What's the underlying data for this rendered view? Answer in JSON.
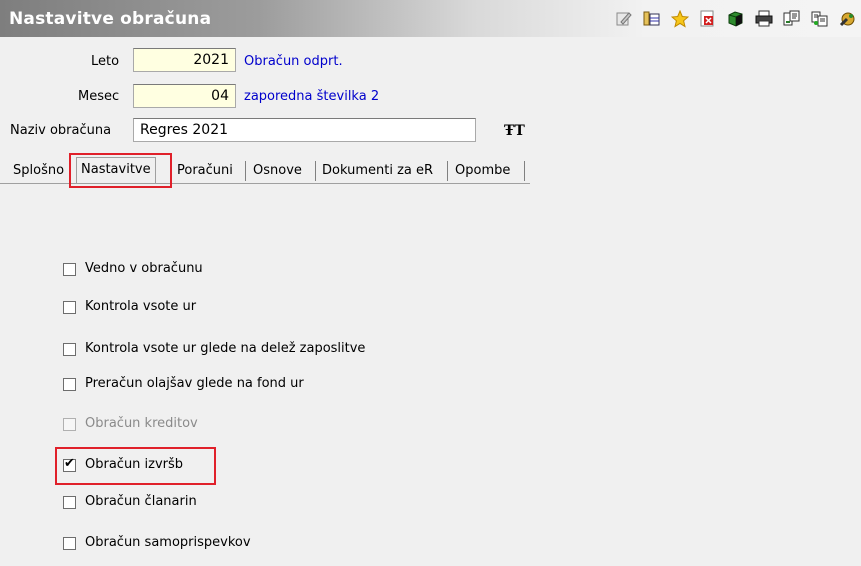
{
  "window": {
    "title": "Nastavitve obračuna"
  },
  "toolbar": {
    "icons": [
      "edit-icon",
      "table-icon",
      "star-icon",
      "delete-icon",
      "cube-icon",
      "print-icon",
      "export-icon",
      "copy-icon",
      "tool-icon"
    ]
  },
  "form": {
    "leto_label": "Leto",
    "leto_value": "2021",
    "leto_status": "Obračun odprt.",
    "mesec_label": "Mesec",
    "mesec_value": "04",
    "mesec_status": "zaporedna številka 2",
    "naziv_label": "Naziv obračuna",
    "naziv_value": "Regres 2021"
  },
  "tabs": [
    {
      "label": "Splošno",
      "active": false
    },
    {
      "label": "Nastavitve",
      "active": true
    },
    {
      "label": "Poračuni",
      "active": false
    },
    {
      "label": "Osnove",
      "active": false
    },
    {
      "label": "Dokumenti za eR",
      "active": false
    },
    {
      "label": "Opombe",
      "active": false
    }
  ],
  "settings": [
    {
      "label": "Vedno v obračunu",
      "checked": false,
      "disabled": false
    },
    {
      "label": "Kontrola vsote ur",
      "checked": false,
      "disabled": false
    },
    {
      "label": "Kontrola vsote ur glede na delež zaposlitve",
      "checked": false,
      "disabled": false
    },
    {
      "label": "Preračun olajšav glede na fond ur",
      "checked": false,
      "disabled": false
    },
    {
      "label": "Obračun kreditov",
      "checked": false,
      "disabled": true
    },
    {
      "label": "Obračun izvršb",
      "checked": true,
      "disabled": false
    },
    {
      "label": "Obračun članarin",
      "checked": false,
      "disabled": false
    },
    {
      "label": "Obračun samoprispevkov",
      "checked": false,
      "disabled": false
    }
  ]
}
